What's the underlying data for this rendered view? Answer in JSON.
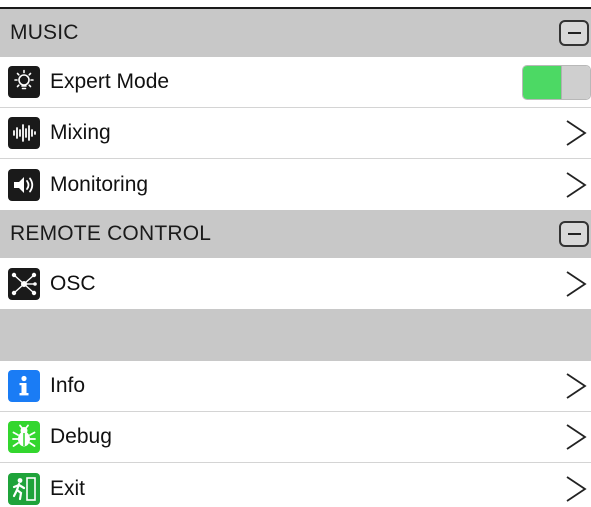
{
  "sections": {
    "music": {
      "title": "MUSIC"
    },
    "remote": {
      "title": "REMOTE CONTROL"
    }
  },
  "rows": {
    "expert_mode": {
      "label": "Expert Mode",
      "icon": "lightbulb-icon",
      "toggle_on": true
    },
    "mixing": {
      "label": "Mixing",
      "icon": "waveform-icon"
    },
    "monitoring": {
      "label": "Monitoring",
      "icon": "speaker-icon"
    },
    "osc": {
      "label": "OSC",
      "icon": "network-icon"
    },
    "info": {
      "label": "Info",
      "icon": "info-icon"
    },
    "debug": {
      "label": "Debug",
      "icon": "bug-icon"
    },
    "exit": {
      "label": "Exit",
      "icon": "exit-icon"
    }
  },
  "colors": {
    "section_bg": "#c8c8c8",
    "toggle_on": "#4cd964",
    "info_blue": "#1a7cf5",
    "debug_green": "#33d62e",
    "exit_green": "#1fa33a"
  }
}
